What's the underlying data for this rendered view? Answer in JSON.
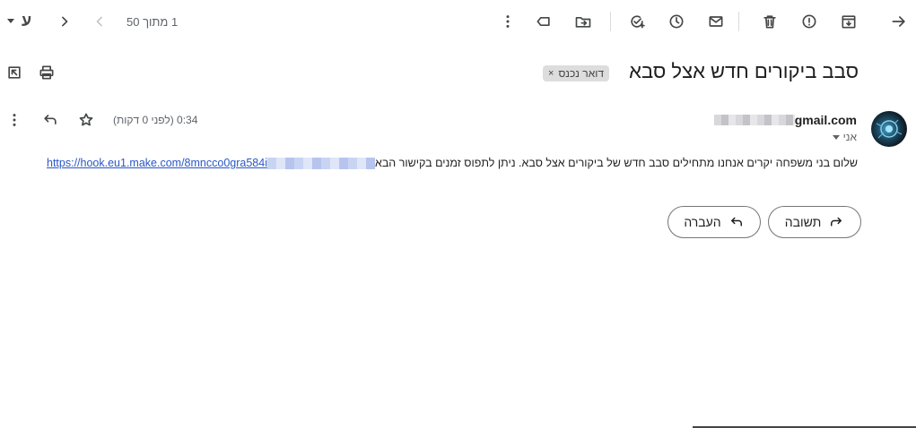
{
  "toolbar": {
    "input_tool_label": "ע",
    "pager_text": "1 מתוך 50"
  },
  "email": {
    "subject": "סבב ביקורים חדש אצל סבא",
    "label": "דואר נכנס",
    "label_remove": "×",
    "sender_email_suffix": "gmail.com",
    "recipient": "אני",
    "time": "0:34 (לפני 0 דקות)",
    "body_text": "שלום בני משפחה יקרים אנחנו מתחילים סבב חדש של ביקורים אצל סבא. ניתן לתפוס זמנים בקישור הבא",
    "link_visible": "https://hook.eu1.make.com/8mncco0gra584i"
  },
  "actions": {
    "reply_label": "תשובה",
    "forward_label": "העברה"
  },
  "colors": {
    "link": "#2a57c8",
    "icon": "#444746",
    "chip_bg": "#dddddd"
  }
}
